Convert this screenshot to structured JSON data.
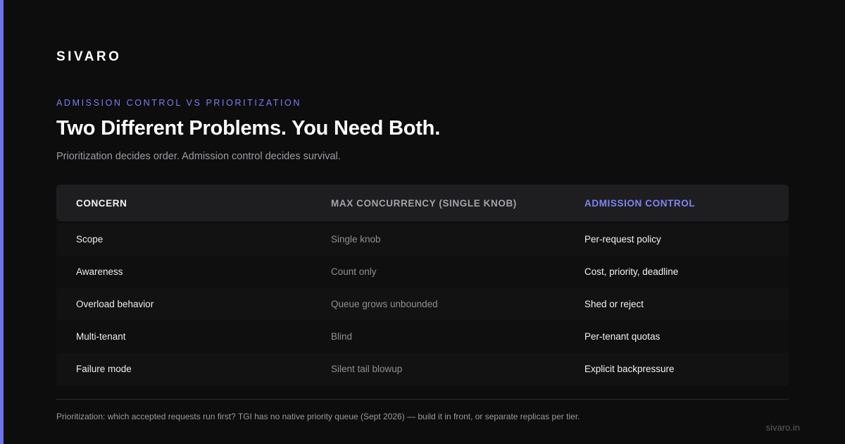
{
  "brand": "SIVARO",
  "eyebrow": "ADMISSION CONTROL VS PRIORITIZATION",
  "headline": "Two Different Problems. You Need Both.",
  "subhead": "Prioritization decides order. Admission control decides survival.",
  "table": {
    "headers": [
      "CONCERN",
      "MAX CONCURRENCY (SINGLE KNOB)",
      "ADMISSION CONTROL"
    ],
    "rows": [
      [
        "Scope",
        "Single knob",
        "Per-request policy"
      ],
      [
        "Awareness",
        "Count only",
        "Cost, priority, deadline"
      ],
      [
        "Overload behavior",
        "Queue grows unbounded",
        "Shed or reject"
      ],
      [
        "Multi-tenant",
        "Blind",
        "Per-tenant quotas"
      ],
      [
        "Failure mode",
        "Silent tail blowup",
        "Explicit backpressure"
      ]
    ]
  },
  "footnote": "Prioritization: which accepted requests run first? TGI has no native priority queue (Sept 2026) — build it in front, or separate replicas per tier.",
  "site": "sivaro.in",
  "colors": {
    "background": "#0d0d0e",
    "accent": "#6e72ea",
    "header_row": "#1e1e21",
    "highlight_header": "#8084f2"
  }
}
